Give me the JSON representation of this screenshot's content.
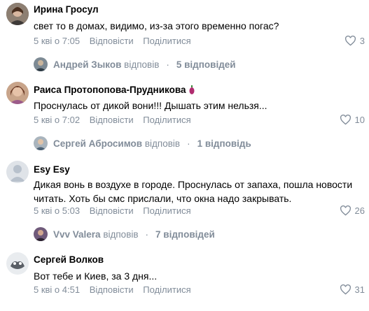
{
  "comments": [
    {
      "author": "Ирина Гросул",
      "text": "свет то в домах, видимо, из-за этого временно погас?",
      "time": "5 кві о 7:05",
      "reply_label": "Відповісти",
      "share_label": "Поділитися",
      "likes": "3",
      "replies": {
        "user": "Андрей Зыков",
        "verb": "відповів",
        "count": "5 відповідей"
      }
    },
    {
      "author": "Раиса Протопопова-Прудникова",
      "text": "Проснулась от дикой вони!!! Дышать этим нельзя...",
      "time": "5 кві о 7:02",
      "reply_label": "Відповісти",
      "share_label": "Поділитися",
      "likes": "10",
      "replies": {
        "user": "Сергей Абросимов",
        "verb": "відповів",
        "count": "1 відповідь"
      }
    },
    {
      "author": "Esy Esy",
      "text": "Дикая вонь в воздухе в городе. Проснулась от запаха, пошла новости читать. Хоть бы смс прислали, что окна надо закрывать.",
      "time": "5 кві о 5:03",
      "reply_label": "Відповісти",
      "share_label": "Поділитися",
      "likes": "26",
      "replies": {
        "user": "Vvv Valera",
        "verb": "відповів",
        "count": "7 відповідей"
      }
    },
    {
      "author": "Сергей Волков",
      "text": "Вот тебе и Киев, за 3 дня...",
      "time": "5 кві о 4:51",
      "reply_label": "Відповісти",
      "share_label": "Поділитися",
      "likes": "31"
    }
  ],
  "colors": {
    "meta": "#818c99",
    "text": "#000000",
    "background": "#ffffff"
  },
  "icons": {
    "like": "heart-icon"
  }
}
